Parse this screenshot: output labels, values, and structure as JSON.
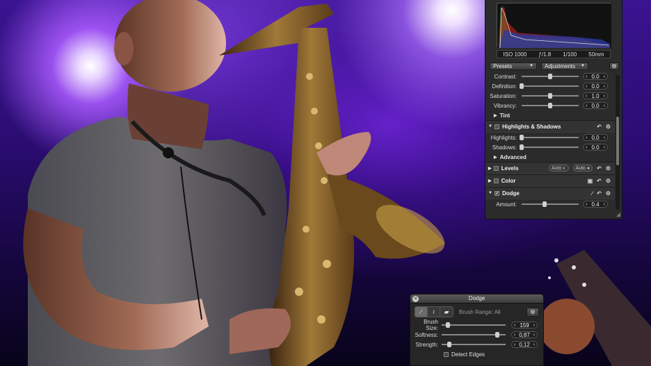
{
  "inspector": {
    "exif": {
      "iso": "ISO 1000",
      "aperture": "ƒ/1.8",
      "shutter": "1/100",
      "focal": "50mm"
    },
    "tabs": {
      "presets": "Presets",
      "adjustments": "Adjustments"
    },
    "enhance_rows": [
      {
        "label": "Contrast:",
        "value": "0.0",
        "level": 0.5
      },
      {
        "label": "Definition:",
        "value": "0.0",
        "level": 0.0
      },
      {
        "label": "Saturation:",
        "value": "1.0",
        "level": 0.5
      },
      {
        "label": "Vibrancy:",
        "value": "0.0",
        "level": 0.5
      }
    ],
    "tint_label": "Tint",
    "highlights_shadows": {
      "title": "Highlights & Shadows",
      "rows": [
        {
          "label": "Highlights:",
          "value": "0.0",
          "level": 0.0
        },
        {
          "label": "Shadows:",
          "value": "0.0",
          "level": 0.0
        }
      ],
      "advanced_label": "Advanced"
    },
    "levels": {
      "title": "Levels",
      "auto1": "Auto",
      "auto2": "Auto"
    },
    "color": {
      "title": "Color"
    },
    "dodge": {
      "title": "Dodge",
      "amount_label": "Amount:",
      "amount_value": "0.4",
      "amount_level": 0.4
    }
  },
  "hud": {
    "title": "Dodge",
    "brush_range": "Brush Range: All",
    "rows": [
      {
        "label": "Brush Size:",
        "value": "159",
        "level": 0.1
      },
      {
        "label": "Softness:",
        "value": "0,87",
        "level": 0.87
      },
      {
        "label": "Strength:",
        "value": "0,12",
        "level": 0.12
      }
    ],
    "detect_edges": "Detect Edges"
  },
  "colors": {
    "stage_light": "#5a22d0",
    "panel_bg": "#2b2b2b",
    "hud_bg": "#282828"
  }
}
